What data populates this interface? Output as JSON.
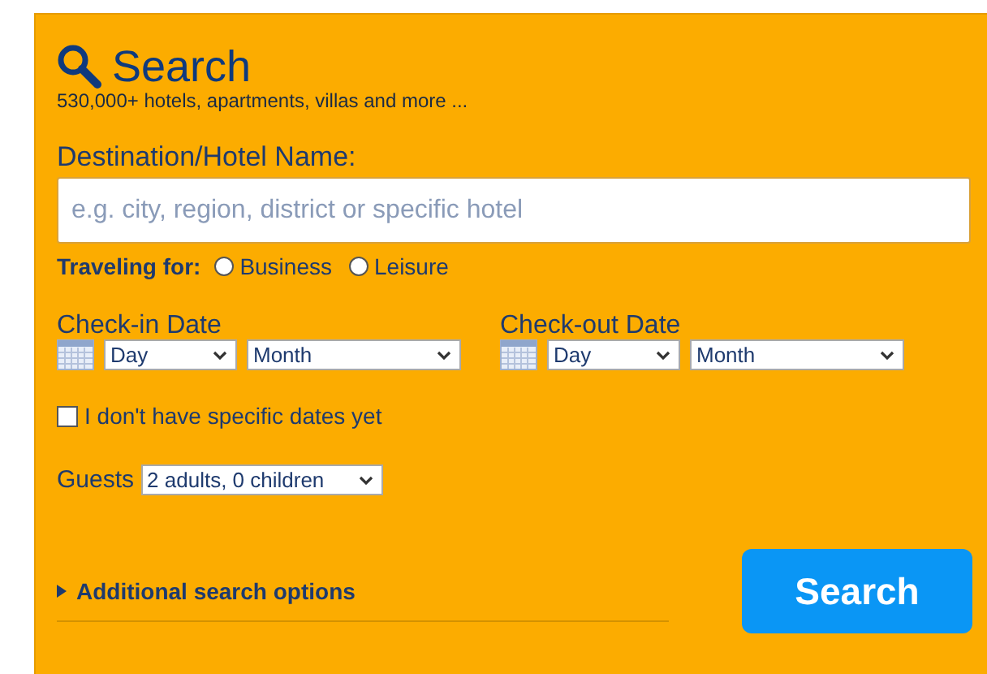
{
  "title": "Search",
  "subtitle": "530,000+ hotels, apartments, villas and more ...",
  "destination": {
    "label": "Destination/Hotel Name:",
    "placeholder": "e.g. city, region, district or specific hotel"
  },
  "traveling_for": {
    "label": "Traveling for:",
    "options": [
      {
        "label": "Business",
        "selected": false
      },
      {
        "label": "Leisure",
        "selected": false
      }
    ]
  },
  "dates": [
    {
      "label": "Check-in Date",
      "day": "Day",
      "month": "Month"
    },
    {
      "label": "Check-out Date",
      "day": "Day",
      "month": "Month"
    }
  ],
  "no_dates": {
    "label": "I don't have specific dates yet",
    "checked": false
  },
  "guests": {
    "label": "Guests",
    "value": "2 adults, 0 children"
  },
  "additional_options": {
    "label": "Additional search options",
    "expanded": false
  },
  "search_button": "Search"
}
